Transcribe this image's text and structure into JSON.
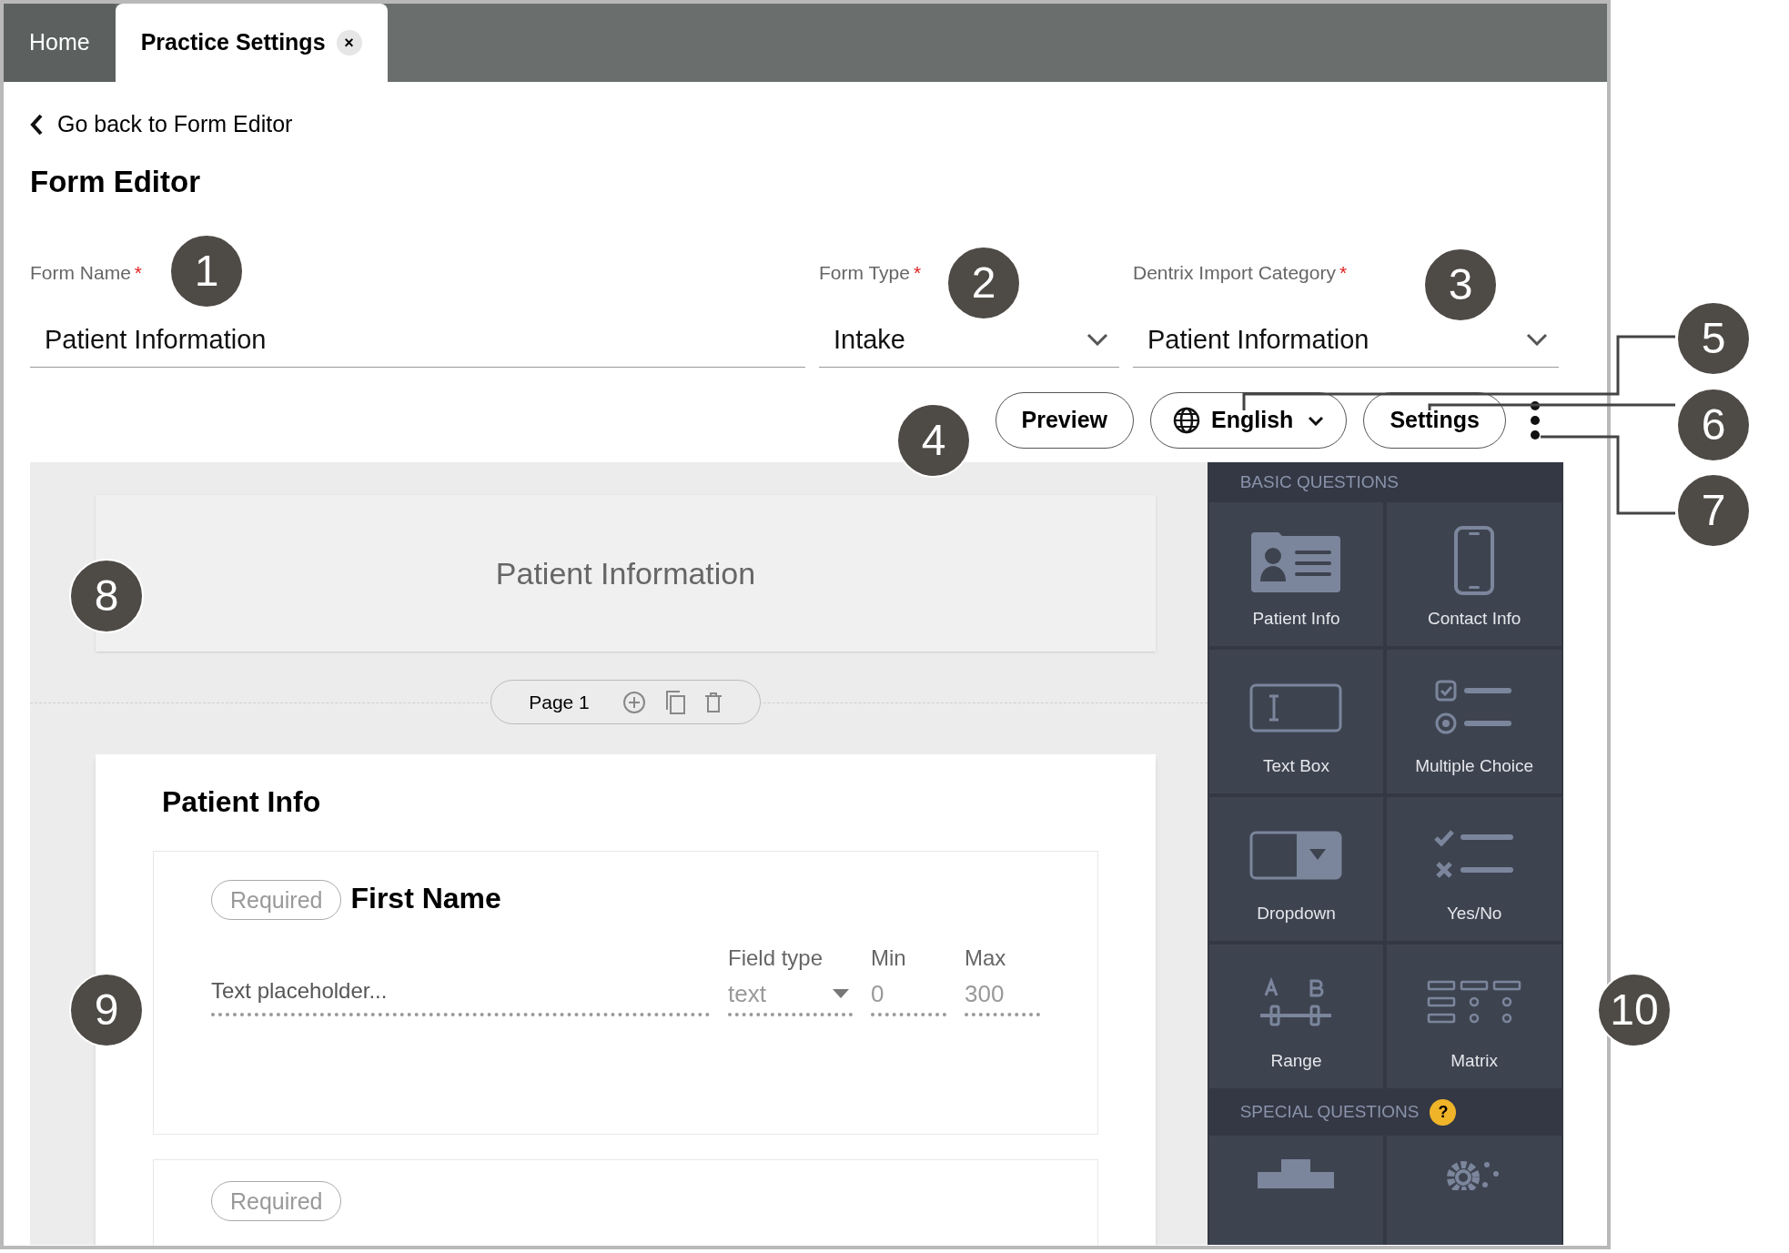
{
  "tabs": [
    {
      "label": "Home",
      "selected": false
    },
    {
      "label": "Practice Settings",
      "selected": true,
      "close": "×"
    }
  ],
  "back_link": "Go back to Form Editor",
  "title": "Form Editor",
  "fields": [
    {
      "kind": "text",
      "label": "Form Name",
      "required_mark": "*",
      "value": "Patient Information"
    },
    {
      "kind": "select",
      "label": "Form Type",
      "required_mark": "*",
      "value": "Intake"
    },
    {
      "kind": "select",
      "label": "Dentrix Import Category",
      "required_mark": "*",
      "value": "Patient Information"
    }
  ],
  "toolbar": {
    "preview": "Preview",
    "language": "English",
    "settings": "Settings"
  },
  "header_card": {
    "title": "Patient Information"
  },
  "page_pill": {
    "label": "Page 1"
  },
  "section": {
    "title": "Patient Info",
    "questions": [
      {
        "badge": "Required",
        "title": "First Name",
        "placeholder": "Text placeholder...",
        "field_type_label": "Field type",
        "field_type": "text",
        "min_label": "Min",
        "min": "0",
        "max_label": "Max",
        "max": "300"
      },
      {
        "badge": "Required"
      }
    ]
  },
  "palette": {
    "basic_header": "BASIC QUESTIONS",
    "items": [
      {
        "kind": "patient",
        "label": "Patient Info"
      },
      {
        "kind": "phone",
        "label": "Contact Info"
      },
      {
        "kind": "textbox",
        "label": "Text Box"
      },
      {
        "kind": "multiple",
        "label": "Multiple Choice"
      },
      {
        "kind": "dropdown",
        "label": "Dropdown"
      },
      {
        "kind": "yesno",
        "label": "Yes/No"
      },
      {
        "kind": "range",
        "label": "Range"
      },
      {
        "kind": "matrix",
        "label": "Matrix"
      }
    ],
    "special_header": "SPECIAL QUESTIONS",
    "special_help": "?",
    "special_items": [
      {
        "kind": "plus"
      },
      {
        "kind": "gear"
      }
    ]
  },
  "callouts": [
    "1",
    "2",
    "3",
    "4",
    "5",
    "6",
    "7",
    "8",
    "9",
    "10"
  ]
}
